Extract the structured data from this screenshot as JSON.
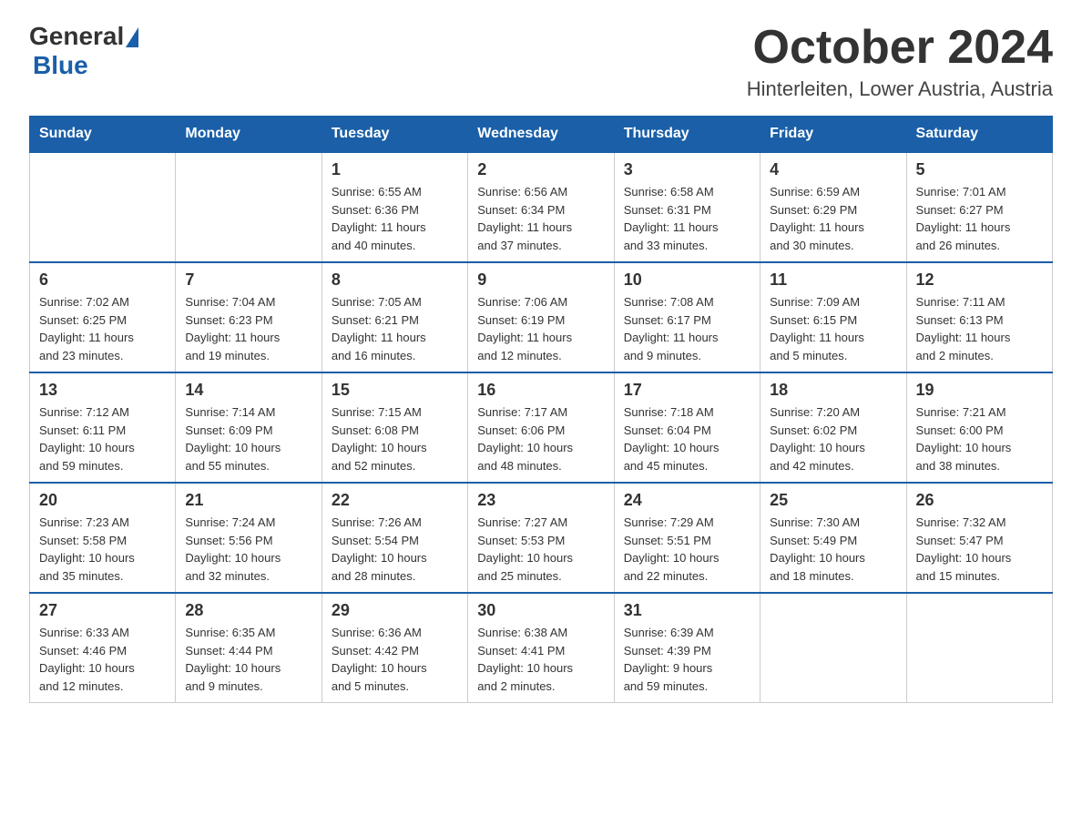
{
  "header": {
    "logo_general": "General",
    "logo_blue": "Blue",
    "month_title": "October 2024",
    "location": "Hinterleiten, Lower Austria, Austria"
  },
  "weekdays": [
    "Sunday",
    "Monday",
    "Tuesday",
    "Wednesday",
    "Thursday",
    "Friday",
    "Saturday"
  ],
  "weeks": [
    [
      {
        "day": "",
        "info": ""
      },
      {
        "day": "",
        "info": ""
      },
      {
        "day": "1",
        "info": "Sunrise: 6:55 AM\nSunset: 6:36 PM\nDaylight: 11 hours\nand 40 minutes."
      },
      {
        "day": "2",
        "info": "Sunrise: 6:56 AM\nSunset: 6:34 PM\nDaylight: 11 hours\nand 37 minutes."
      },
      {
        "day": "3",
        "info": "Sunrise: 6:58 AM\nSunset: 6:31 PM\nDaylight: 11 hours\nand 33 minutes."
      },
      {
        "day": "4",
        "info": "Sunrise: 6:59 AM\nSunset: 6:29 PM\nDaylight: 11 hours\nand 30 minutes."
      },
      {
        "day": "5",
        "info": "Sunrise: 7:01 AM\nSunset: 6:27 PM\nDaylight: 11 hours\nand 26 minutes."
      }
    ],
    [
      {
        "day": "6",
        "info": "Sunrise: 7:02 AM\nSunset: 6:25 PM\nDaylight: 11 hours\nand 23 minutes."
      },
      {
        "day": "7",
        "info": "Sunrise: 7:04 AM\nSunset: 6:23 PM\nDaylight: 11 hours\nand 19 minutes."
      },
      {
        "day": "8",
        "info": "Sunrise: 7:05 AM\nSunset: 6:21 PM\nDaylight: 11 hours\nand 16 minutes."
      },
      {
        "day": "9",
        "info": "Sunrise: 7:06 AM\nSunset: 6:19 PM\nDaylight: 11 hours\nand 12 minutes."
      },
      {
        "day": "10",
        "info": "Sunrise: 7:08 AM\nSunset: 6:17 PM\nDaylight: 11 hours\nand 9 minutes."
      },
      {
        "day": "11",
        "info": "Sunrise: 7:09 AM\nSunset: 6:15 PM\nDaylight: 11 hours\nand 5 minutes."
      },
      {
        "day": "12",
        "info": "Sunrise: 7:11 AM\nSunset: 6:13 PM\nDaylight: 11 hours\nand 2 minutes."
      }
    ],
    [
      {
        "day": "13",
        "info": "Sunrise: 7:12 AM\nSunset: 6:11 PM\nDaylight: 10 hours\nand 59 minutes."
      },
      {
        "day": "14",
        "info": "Sunrise: 7:14 AM\nSunset: 6:09 PM\nDaylight: 10 hours\nand 55 minutes."
      },
      {
        "day": "15",
        "info": "Sunrise: 7:15 AM\nSunset: 6:08 PM\nDaylight: 10 hours\nand 52 minutes."
      },
      {
        "day": "16",
        "info": "Sunrise: 7:17 AM\nSunset: 6:06 PM\nDaylight: 10 hours\nand 48 minutes."
      },
      {
        "day": "17",
        "info": "Sunrise: 7:18 AM\nSunset: 6:04 PM\nDaylight: 10 hours\nand 45 minutes."
      },
      {
        "day": "18",
        "info": "Sunrise: 7:20 AM\nSunset: 6:02 PM\nDaylight: 10 hours\nand 42 minutes."
      },
      {
        "day": "19",
        "info": "Sunrise: 7:21 AM\nSunset: 6:00 PM\nDaylight: 10 hours\nand 38 minutes."
      }
    ],
    [
      {
        "day": "20",
        "info": "Sunrise: 7:23 AM\nSunset: 5:58 PM\nDaylight: 10 hours\nand 35 minutes."
      },
      {
        "day": "21",
        "info": "Sunrise: 7:24 AM\nSunset: 5:56 PM\nDaylight: 10 hours\nand 32 minutes."
      },
      {
        "day": "22",
        "info": "Sunrise: 7:26 AM\nSunset: 5:54 PM\nDaylight: 10 hours\nand 28 minutes."
      },
      {
        "day": "23",
        "info": "Sunrise: 7:27 AM\nSunset: 5:53 PM\nDaylight: 10 hours\nand 25 minutes."
      },
      {
        "day": "24",
        "info": "Sunrise: 7:29 AM\nSunset: 5:51 PM\nDaylight: 10 hours\nand 22 minutes."
      },
      {
        "day": "25",
        "info": "Sunrise: 7:30 AM\nSunset: 5:49 PM\nDaylight: 10 hours\nand 18 minutes."
      },
      {
        "day": "26",
        "info": "Sunrise: 7:32 AM\nSunset: 5:47 PM\nDaylight: 10 hours\nand 15 minutes."
      }
    ],
    [
      {
        "day": "27",
        "info": "Sunrise: 6:33 AM\nSunset: 4:46 PM\nDaylight: 10 hours\nand 12 minutes."
      },
      {
        "day": "28",
        "info": "Sunrise: 6:35 AM\nSunset: 4:44 PM\nDaylight: 10 hours\nand 9 minutes."
      },
      {
        "day": "29",
        "info": "Sunrise: 6:36 AM\nSunset: 4:42 PM\nDaylight: 10 hours\nand 5 minutes."
      },
      {
        "day": "30",
        "info": "Sunrise: 6:38 AM\nSunset: 4:41 PM\nDaylight: 10 hours\nand 2 minutes."
      },
      {
        "day": "31",
        "info": "Sunrise: 6:39 AM\nSunset: 4:39 PM\nDaylight: 9 hours\nand 59 minutes."
      },
      {
        "day": "",
        "info": ""
      },
      {
        "day": "",
        "info": ""
      }
    ]
  ]
}
